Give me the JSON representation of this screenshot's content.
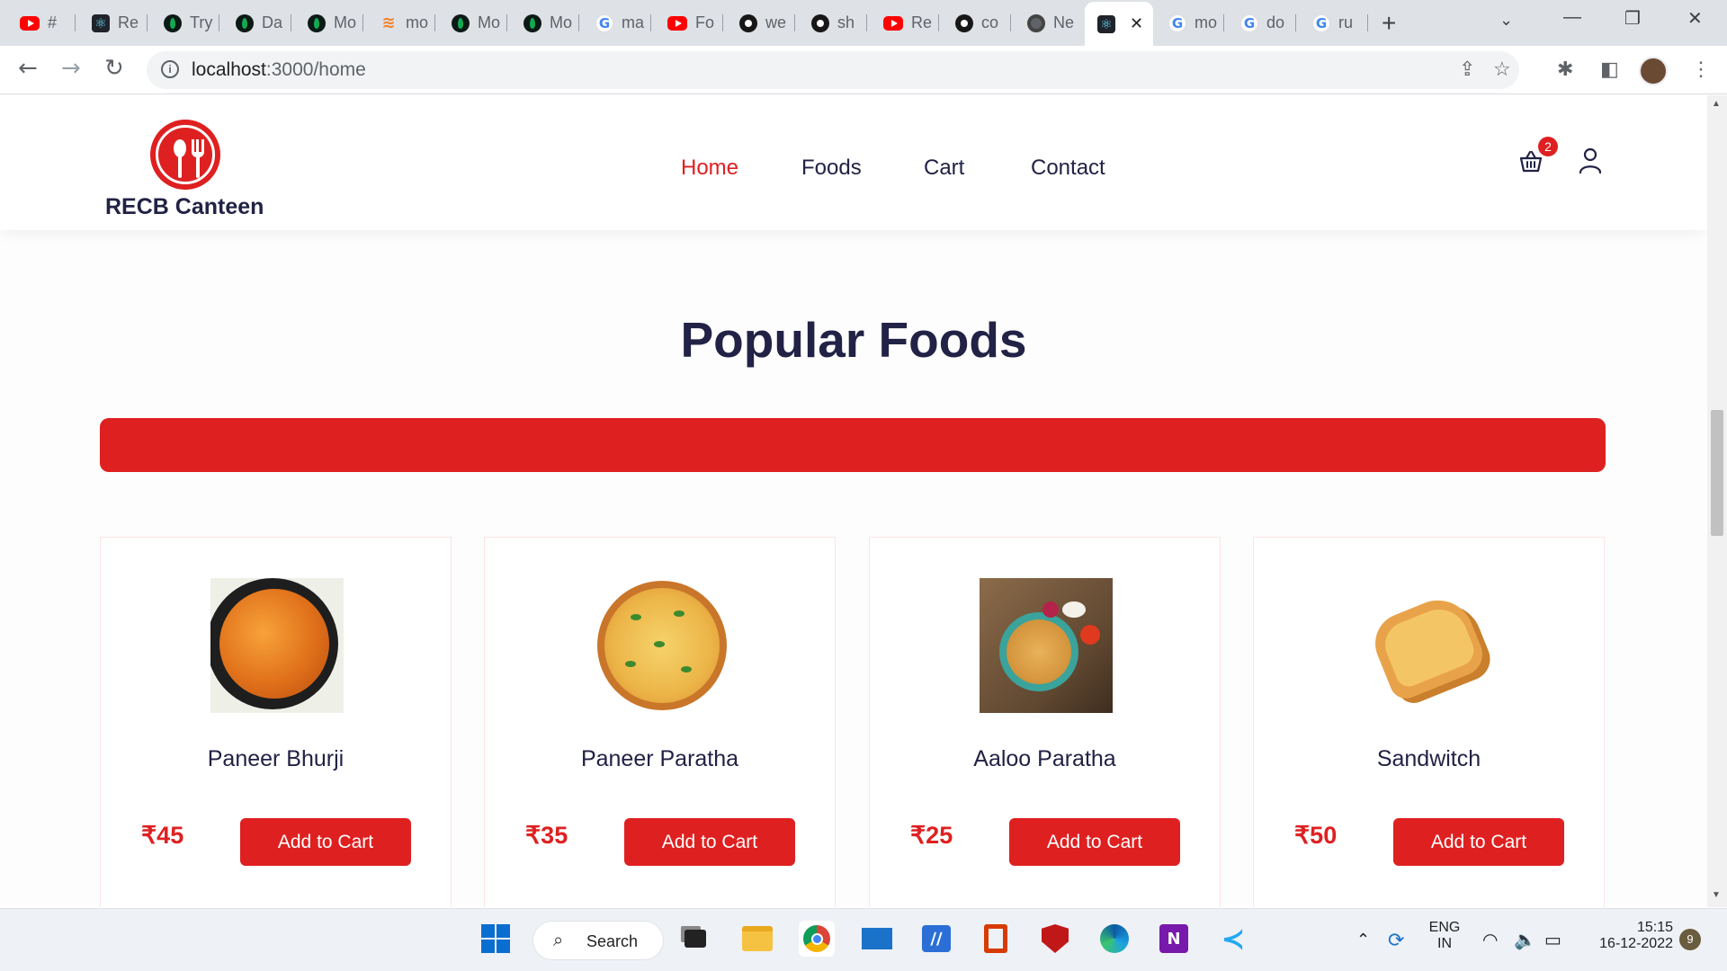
{
  "browser": {
    "tabs": [
      {
        "icon": "youtube-icon",
        "title": "#"
      },
      {
        "icon": "react-icon",
        "title": "Re"
      },
      {
        "icon": "mongodb-icon",
        "title": "Try"
      },
      {
        "icon": "mongodb-icon",
        "title": "Da"
      },
      {
        "icon": "mongodb-icon",
        "title": "Mo"
      },
      {
        "icon": "stackoverflow-icon",
        "title": "mo"
      },
      {
        "icon": "mongodb-icon",
        "title": "Mo"
      },
      {
        "icon": "mongodb-icon",
        "title": "Mo"
      },
      {
        "icon": "google-icon",
        "title": "ma"
      },
      {
        "icon": "youtube-icon",
        "title": "Fo"
      },
      {
        "icon": "github-icon",
        "title": "we"
      },
      {
        "icon": "github-icon",
        "title": "sh"
      },
      {
        "icon": "youtube-icon",
        "title": "Re"
      },
      {
        "icon": "github-icon",
        "title": "co"
      },
      {
        "icon": "chrome-icon",
        "title": "Ne"
      },
      {
        "icon": "react-icon",
        "title": "",
        "active": true
      },
      {
        "icon": "google-icon",
        "title": "mo"
      },
      {
        "icon": "google-icon",
        "title": "do"
      },
      {
        "icon": "google-icon",
        "title": "ru"
      }
    ],
    "new_tab_label": "+",
    "url_host": "localhost",
    "url_path": ":3000/home"
  },
  "site": {
    "brand": "RECB Canteen",
    "nav": [
      "Home",
      "Foods",
      "Cart",
      "Contact"
    ],
    "active_nav": "Home",
    "cart_count": "2",
    "accent_color": "#df2020",
    "text_color": "#212245"
  },
  "section": {
    "title": "Popular Foods"
  },
  "foods": [
    {
      "name": "Paneer Bhurji",
      "price": "₹45",
      "button": "Add to Cart"
    },
    {
      "name": "Paneer Paratha",
      "price": "₹35",
      "button": "Add to Cart"
    },
    {
      "name": "Aaloo Paratha",
      "price": "₹25",
      "button": "Add to Cart"
    },
    {
      "name": "Sandwitch",
      "price": "₹50",
      "button": "Add to Cart"
    }
  ],
  "taskbar": {
    "search_label": "Search",
    "lang": "ENG",
    "region": "IN",
    "time": "15:15",
    "date": "16-12-2022",
    "notifications": "9"
  }
}
